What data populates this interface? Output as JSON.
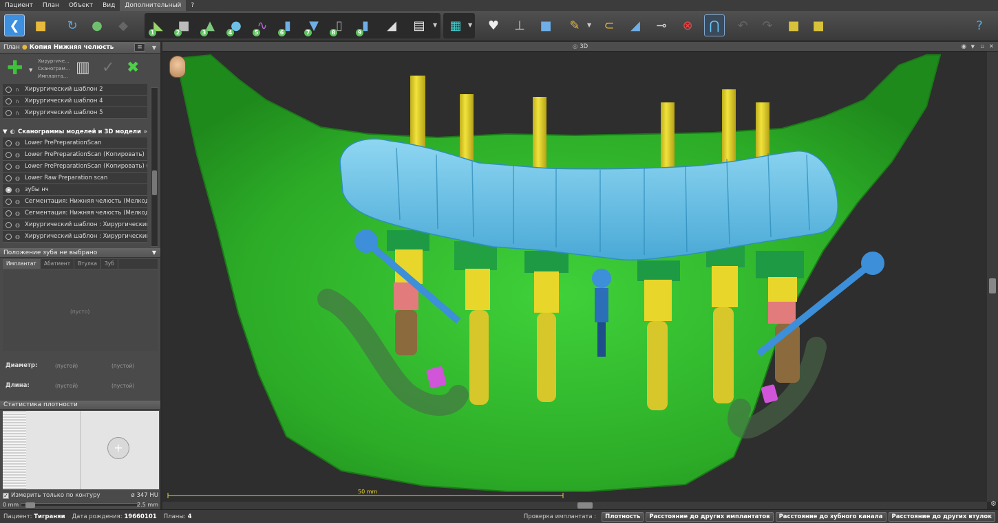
{
  "menu": [
    "Пациент",
    "План",
    "Объект",
    "Вид",
    "Дополнительный",
    "?"
  ],
  "toolbar": {
    "step_numbers": [
      "1",
      "2",
      "3",
      "4",
      "5",
      "6",
      "7",
      "8",
      "9"
    ]
  },
  "plan_panel": {
    "label": "План",
    "name": "Копия Нижняя челюсть",
    "add_menu_lines": [
      "Хирургиче...",
      "Сканограм...",
      "Импланта..."
    ]
  },
  "templates_list": [
    "Хирургический шаблон 2",
    "Хирургический шаблон 4",
    "Хирургический шаблон 5"
  ],
  "scans_section": {
    "title": "Сканограммы моделей и 3D модели",
    "items": [
      "Lower PrePreparationScan",
      "Lower PrePreparationScan (Копировать)",
      "Lower PrePreparationScan (Копировать) (К...",
      "Lower Raw Preparation scan",
      "зубы нч",
      "Сегментация: Нижняя челюсть (Мелкоди...",
      "Сегментация: Нижняя челюсть (Мелкоди...",
      "Хирургический шаблон : Хирургический ...",
      "Хирургический шаблон : Хирургический ..."
    ],
    "selected_index": 4
  },
  "tooth_panel": {
    "title": "Положение зуба не выбрано",
    "tabs": [
      "Имплантат",
      "Абатмент",
      "Втулка",
      "Зуб"
    ],
    "empty_text": "(пусто)",
    "diameter_label": "Диаметр:",
    "length_label": "Длина:",
    "empty_value": "(пустой)"
  },
  "density_panel": {
    "title": "Статистика плотности",
    "contour_checkbox": "Измерить только по контуру",
    "hu_value": "ø 347 HU",
    "range_min": "0 mm",
    "range_max": "2.5 mm"
  },
  "viewport": {
    "title": "3D",
    "scale_label": "50 mm"
  },
  "status": {
    "patient_label": "Пациент:",
    "patient_value": "Тиграняи",
    "dob_label": "Дата рождения:",
    "dob_value": "19660101",
    "plans_label": "Планы:",
    "plans_value": "4",
    "check_label": "Проверка имплантата :",
    "buttons": [
      "Плотность",
      "Расстояние до других имплантатов",
      "Расстояние до зубного канала",
      "Расстояние до других втулок"
    ]
  },
  "colors": {
    "bone": "#2fb82a",
    "teeth": "#63c3ea",
    "implant": "#e8d72a",
    "pin": "#3c8fd8",
    "accent_pink": "#e27b7b",
    "sleeve_green": "#1e9a45"
  }
}
